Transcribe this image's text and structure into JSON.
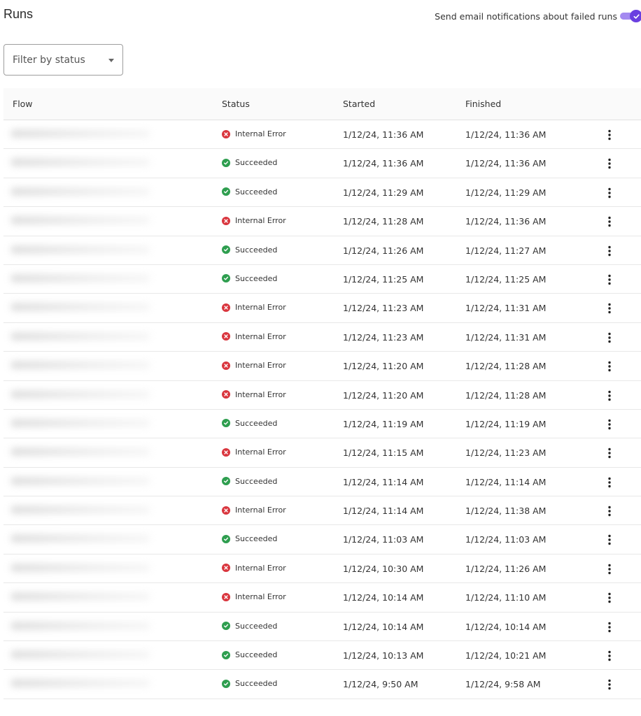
{
  "page": {
    "title": "Runs"
  },
  "notifications": {
    "label": "Send email notifications about failed runs",
    "enabled": true,
    "accent": "#6a3fe0"
  },
  "filter": {
    "placeholder": "Filter by status"
  },
  "table": {
    "columns": {
      "flow": "Flow",
      "status": "Status",
      "started": "Started",
      "finished": "Finished"
    },
    "status_colors": {
      "Internal Error": "#d9363e",
      "Succeeded": "#2e9e4f"
    },
    "rows": [
      {
        "status": "Internal Error",
        "started": "1/12/24, 11:36 AM",
        "finished": "1/12/24, 11:36 AM"
      },
      {
        "status": "Succeeded",
        "started": "1/12/24, 11:36 AM",
        "finished": "1/12/24, 11:36 AM"
      },
      {
        "status": "Succeeded",
        "started": "1/12/24, 11:29 AM",
        "finished": "1/12/24, 11:29 AM"
      },
      {
        "status": "Internal Error",
        "started": "1/12/24, 11:28 AM",
        "finished": "1/12/24, 11:36 AM"
      },
      {
        "status": "Succeeded",
        "started": "1/12/24, 11:26 AM",
        "finished": "1/12/24, 11:27 AM"
      },
      {
        "status": "Succeeded",
        "started": "1/12/24, 11:25 AM",
        "finished": "1/12/24, 11:25 AM"
      },
      {
        "status": "Internal Error",
        "started": "1/12/24, 11:23 AM",
        "finished": "1/12/24, 11:31 AM"
      },
      {
        "status": "Internal Error",
        "started": "1/12/24, 11:23 AM",
        "finished": "1/12/24, 11:31 AM"
      },
      {
        "status": "Internal Error",
        "started": "1/12/24, 11:20 AM",
        "finished": "1/12/24, 11:28 AM"
      },
      {
        "status": "Internal Error",
        "started": "1/12/24, 11:20 AM",
        "finished": "1/12/24, 11:28 AM"
      },
      {
        "status": "Succeeded",
        "started": "1/12/24, 11:19 AM",
        "finished": "1/12/24, 11:19 AM"
      },
      {
        "status": "Internal Error",
        "started": "1/12/24, 11:15 AM",
        "finished": "1/12/24, 11:23 AM"
      },
      {
        "status": "Succeeded",
        "started": "1/12/24, 11:14 AM",
        "finished": "1/12/24, 11:14 AM"
      },
      {
        "status": "Internal Error",
        "started": "1/12/24, 11:14 AM",
        "finished": "1/12/24, 11:38 AM"
      },
      {
        "status": "Succeeded",
        "started": "1/12/24, 11:03 AM",
        "finished": "1/12/24, 11:03 AM"
      },
      {
        "status": "Internal Error",
        "started": "1/12/24, 10:30 AM",
        "finished": "1/12/24, 11:26 AM"
      },
      {
        "status": "Internal Error",
        "started": "1/12/24, 10:14 AM",
        "finished": "1/12/24, 11:10 AM"
      },
      {
        "status": "Succeeded",
        "started": "1/12/24, 10:14 AM",
        "finished": "1/12/24, 10:14 AM"
      },
      {
        "status": "Succeeded",
        "started": "1/12/24, 10:13 AM",
        "finished": "1/12/24, 10:21 AM"
      },
      {
        "status": "Succeeded",
        "started": "1/12/24, 9:50 AM",
        "finished": "1/12/24, 9:58 AM"
      }
    ]
  }
}
